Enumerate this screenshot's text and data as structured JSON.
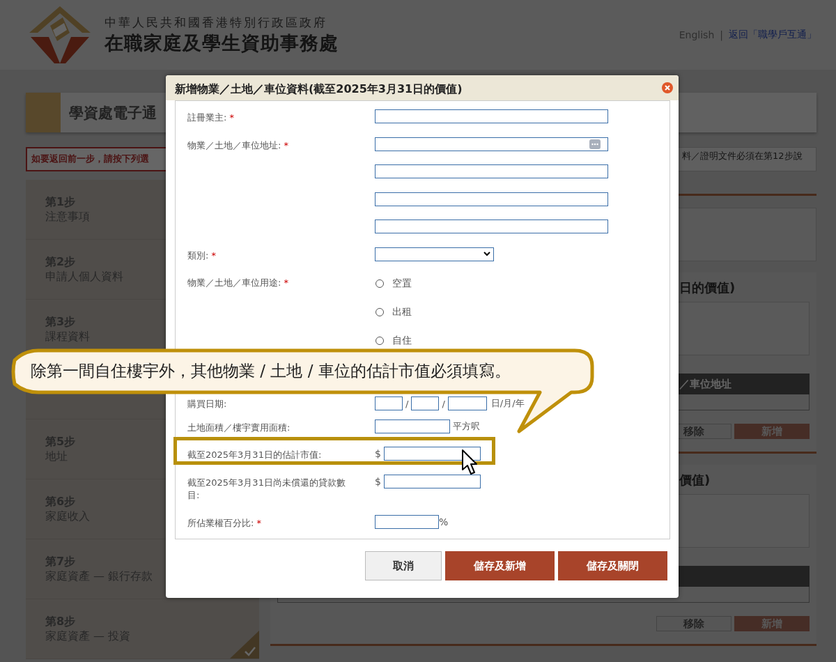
{
  "header": {
    "gov_name": "中華人民共和國香港特別行政區政府",
    "dept_name": "在職家庭及學生資助事務處",
    "links": [
      {
        "label": "English"
      },
      {
        "label": "返回「職學戶互通」"
      }
    ],
    "separator": "|"
  },
  "banner": {
    "title": "學資處電子通"
  },
  "back_notice": "如要返回前一步，請按下列選",
  "info_notice": "料／證明文件必須在第12步說",
  "steps": [
    {
      "kind": "step",
      "step": "第1步",
      "label": "注意事項"
    },
    {
      "kind": "step",
      "step": "第2步",
      "label": "申請人個人資料"
    },
    {
      "kind": "step",
      "step": "第3步",
      "label": "課程資料"
    },
    {
      "kind": "covered"
    },
    {
      "kind": "step",
      "step": "第5步",
      "label": "地址",
      "checked": false
    },
    {
      "kind": "step",
      "step": "第6步",
      "label": "家庭收入",
      "checked": false
    },
    {
      "kind": "step",
      "step": "第7步",
      "label": "家庭資產 — 銀行存款",
      "checked": false
    },
    {
      "kind": "step",
      "step": "第8步",
      "label": "家庭資產 — 投資",
      "checked": true
    }
  ],
  "sections": [
    {
      "title": "日的價值)",
      "table_header": "／車位地址",
      "buttons": [
        {
          "label": "移除",
          "kind": "secondary"
        },
        {
          "label": "新增",
          "kind": "primary"
        }
      ]
    },
    {
      "title": "價值)",
      "buttons": [
        {
          "label": "移除",
          "kind": "secondary"
        },
        {
          "label": "新增",
          "kind": "primary"
        }
      ]
    }
  ],
  "dialog": {
    "title": "新增物業／土地／車位資料(截至2025年3月31日的價值)",
    "fields": [
      {
        "kind": "text",
        "label": "註冊業主:",
        "required_mark": "*"
      },
      {
        "kind": "address",
        "label": "物業／土地／車位地址:",
        "required_mark": "*"
      },
      {
        "kind": "text"
      },
      {
        "kind": "text"
      },
      {
        "kind": "text"
      },
      {
        "kind": "select",
        "label": "類別:",
        "required_mark": "*"
      },
      {
        "kind": "radio",
        "label": "物業／土地／車位用途:",
        "required_mark": "*",
        "options": [
          {
            "label": "空置",
            "selected": false
          },
          {
            "label": "出租",
            "selected": false
          },
          {
            "label": "自住",
            "selected": false
          }
        ]
      },
      {
        "kind": "date",
        "label": "購買日期:",
        "separators": [
          "/",
          "/"
        ],
        "hint": "日/月/年"
      },
      {
        "kind": "unit",
        "label": "土地面積／樓宇實用面積:",
        "unit": "平方呎"
      },
      {
        "kind": "money",
        "label": "截至2025年3月31日的估計市值:",
        "prefix": "$",
        "highlighted": true
      },
      {
        "kind": "money",
        "label": "截至2025年3月31日尚未償還的貸款數目:",
        "prefix": "$",
        "highlighted": false
      },
      {
        "kind": "percent",
        "label": "所佔業權百分比:",
        "required_mark": "*",
        "unit": "%"
      }
    ],
    "buttons": [
      {
        "label": "取消",
        "kind": "secondary"
      },
      {
        "label": "儲存及新增",
        "kind": "primary"
      },
      {
        "label": "儲存及關閉",
        "kind": "primary"
      }
    ]
  },
  "callout": {
    "text": "除第一間自住樓宇外，其他物業 / 土地 / 車位的估計市值必須填寫。"
  }
}
